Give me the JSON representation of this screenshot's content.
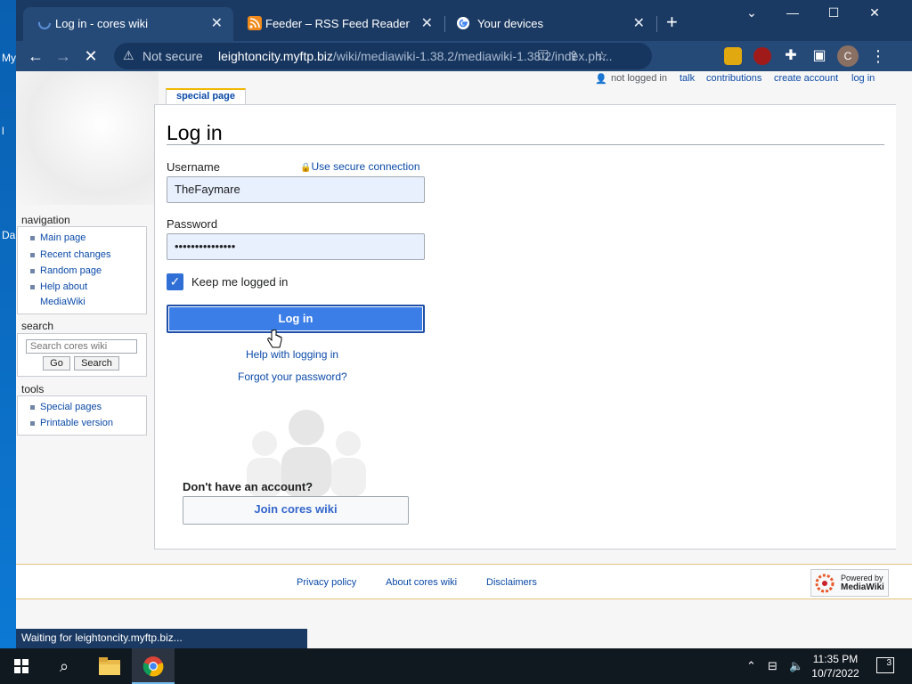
{
  "desktop": {
    "label1": "My",
    "label2": "l",
    "label3": "Da"
  },
  "tabs": [
    {
      "title": "Log in - cores wiki",
      "close": "✕"
    },
    {
      "title": "Feeder – RSS Feed Reader",
      "close": "✕"
    },
    {
      "title": "Your devices",
      "close": "✕"
    }
  ],
  "new_tab": "+",
  "window_controls": {
    "dropdown": "⌄",
    "minimize": "—",
    "maximize": "☐",
    "close": "✕"
  },
  "toolbar": {
    "back": "←",
    "forward": "→",
    "reload": "✕",
    "security_label": "Not secure",
    "url_host": "leightoncity.myftp.biz",
    "url_path": "/wiki/mediawiki-1.38.2/mediawiki-1.38.2/index.ph...",
    "avatar_letter": "C"
  },
  "personal_tools": {
    "not_logged_in": "not logged in",
    "talk": "talk",
    "contributions": "contributions",
    "create_account": "create account",
    "log_in": "log in"
  },
  "special_page_tab": "special page",
  "form": {
    "heading": "Log in",
    "username_label": "Username",
    "secure_link": "Use secure connection",
    "username_value": "TheFaymare",
    "password_label": "Password",
    "password_value": "•••••••••••••••",
    "keep_logged_in": "Keep me logged in",
    "keep_logged_in_checked": true,
    "login_button": "Log in",
    "help_link": "Help with logging in",
    "forgot_link": "Forgot your password?",
    "no_account": "Don't have an account?",
    "join_button": "Join cores wiki"
  },
  "sidebar": {
    "navigation_heading": "navigation",
    "navigation_items": [
      "Main page",
      "Recent changes",
      "Random page",
      "Help about",
      "MediaWiki"
    ],
    "search_heading": "search",
    "search_placeholder": "Search cores wiki",
    "go_button": "Go",
    "search_button": "Search",
    "tools_heading": "tools",
    "tools_items": [
      "Special pages",
      "Printable version"
    ]
  },
  "footer": {
    "privacy": "Privacy policy",
    "about": "About cores wiki",
    "disclaimers": "Disclaimers",
    "powered_line1": "Powered by",
    "powered_line2": "MediaWiki"
  },
  "status_bar": "Waiting for leightoncity.myftp.biz...",
  "taskbar": {
    "time": "11:35 PM",
    "date": "10/7/2022",
    "notifications": "3"
  }
}
